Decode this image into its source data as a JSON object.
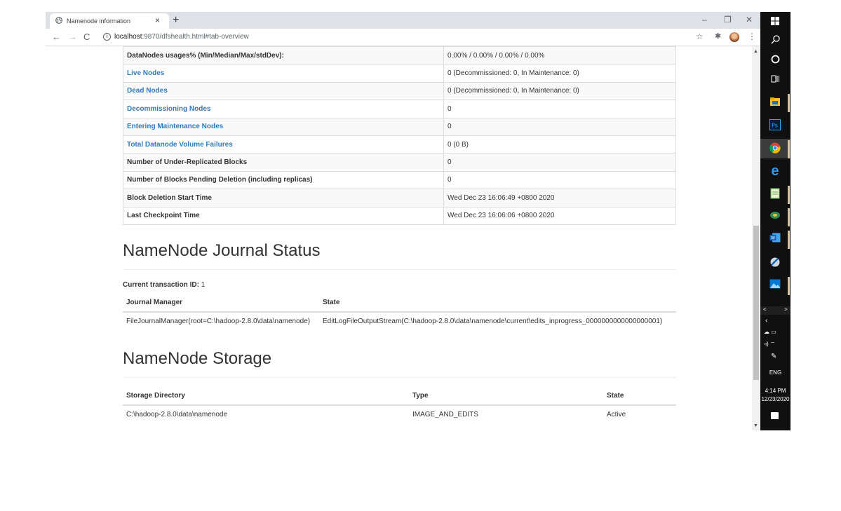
{
  "browser": {
    "tab_title": "Namenode information",
    "tab_close": "×",
    "new_tab": "+",
    "url_host": "localhost",
    "url_rest": ":9870/dfshealth.html#tab-overview",
    "window_controls": {
      "minimize": "–",
      "restore": "❐",
      "close": "✕"
    },
    "nav": {
      "back": "←",
      "forward": "→",
      "reload": "C"
    },
    "star": "☆",
    "extensions": "✱",
    "menu": "⋮"
  },
  "overview": {
    "rows": [
      {
        "label": "DataNodes usages% (Min/Median/Max/stdDev):",
        "value": "0.00% / 0.00% / 0.00% / 0.00%",
        "link": false
      },
      {
        "label": "Live Nodes",
        "value": "0 (Decommissioned: 0, In Maintenance: 0)",
        "link": true
      },
      {
        "label": "Dead Nodes",
        "value": "0 (Decommissioned: 0, In Maintenance: 0)",
        "link": true
      },
      {
        "label": "Decommissioning Nodes",
        "value": "0",
        "link": true
      },
      {
        "label": "Entering Maintenance Nodes",
        "value": "0",
        "link": true
      },
      {
        "label": "Total Datanode Volume Failures",
        "value": "0 (0 B)",
        "link": true
      },
      {
        "label": "Number of Under-Replicated Blocks",
        "value": "0",
        "link": false
      },
      {
        "label": "Number of Blocks Pending Deletion (including replicas)",
        "value": "0",
        "link": false
      },
      {
        "label": "Block Deletion Start Time",
        "value": "Wed Dec 23 16:06:49 +0800 2020",
        "link": false
      },
      {
        "label": "Last Checkpoint Time",
        "value": "Wed Dec 23 16:06:06 +0800 2020",
        "link": false
      }
    ]
  },
  "journal": {
    "heading": "NameNode Journal Status",
    "txn_label": "Current transaction ID:",
    "txn_value": "1",
    "columns": [
      "Journal Manager",
      "State"
    ],
    "rows": [
      [
        "FileJournalManager(root=C:\\hadoop-2.8.0\\data\\namenode)",
        "EditLogFileOutputStream(C:\\hadoop-2.8.0\\data\\namenode\\current\\edits_inprogress_0000000000000000001)"
      ]
    ]
  },
  "storage": {
    "heading": "NameNode Storage",
    "columns": [
      "Storage Directory",
      "Type",
      "State"
    ],
    "rows": [
      [
        "C:\\hadoop-2.8.0\\data\\namenode",
        "IMAGE_AND_EDITS",
        "Active"
      ]
    ]
  },
  "taskbar": {
    "icons": [
      "windows-start",
      "search",
      "cortana",
      "task-view",
      "file-explorer",
      "photoshop",
      "chrome",
      "edge",
      "notepad",
      "network-app",
      "word",
      "tool-app",
      "photos"
    ],
    "tray": {
      "language": "ENG",
      "time": "4:14 PM",
      "date": "12/23/2020"
    }
  },
  "colors": {
    "link": "#337ab7",
    "text": "#333333",
    "taskbar": "#101010",
    "stripe": "#f9f9f9"
  }
}
